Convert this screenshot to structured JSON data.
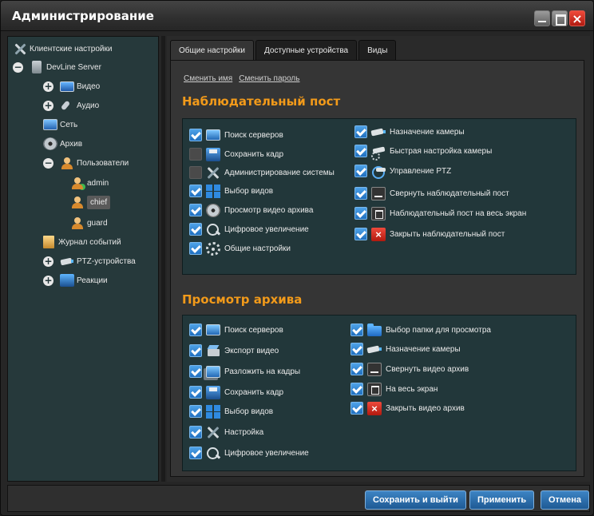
{
  "window": {
    "title": "Администрирование",
    "controls": {
      "minimize": "minimize-icon",
      "maximize": "maximize-icon",
      "close": "×"
    }
  },
  "tree": {
    "items": [
      {
        "label": "Клиентские настройки",
        "icon": "tools-icon"
      },
      {
        "label": "DevLine Server",
        "icon": "server-icon",
        "expander": "−"
      },
      {
        "label": "Видео",
        "icon": "monitor-icon",
        "expander": "+"
      },
      {
        "label": "Аудио",
        "icon": "microphone-icon",
        "expander": "+"
      },
      {
        "label": "Сеть",
        "icon": "network-icon"
      },
      {
        "label": "Архив",
        "icon": "archive-reel-icon"
      },
      {
        "label": "Пользователи",
        "icon": "users-icon",
        "expander": "−"
      },
      {
        "label": "admin",
        "icon": "user-admin-icon"
      },
      {
        "label": "chief",
        "icon": "user-icon",
        "selected": true
      },
      {
        "label": "guard",
        "icon": "user-icon"
      },
      {
        "label": "Журнал событий",
        "icon": "journal-icon"
      },
      {
        "label": "PTZ-устройства",
        "icon": "ptz-camera-icon",
        "expander": "+"
      },
      {
        "label": "Реакции",
        "icon": "reactions-icon",
        "expander": "+"
      }
    ]
  },
  "tabs": [
    {
      "label": "Общие настройки",
      "active": true
    },
    {
      "label": "Доступные устройства",
      "active": false
    },
    {
      "label": "Виды",
      "active": false
    }
  ],
  "links": {
    "change_name": "Сменить имя",
    "change_password": "Сменить пароль"
  },
  "sections": {
    "observation": {
      "title": "Наблюдательный пост",
      "left": [
        {
          "label": "Поиск серверов",
          "checked": true,
          "icon": "monitor-icon"
        },
        {
          "label": "Сохранить кадр",
          "checked": false,
          "icon": "save-icon"
        },
        {
          "label": "Администрирование системы",
          "checked": false,
          "icon": "tools-icon"
        },
        {
          "label": "Выбор видов",
          "checked": true,
          "icon": "grid-icon"
        },
        {
          "label": "Просмотр видео архива",
          "checked": true,
          "icon": "film-reel-icon"
        },
        {
          "label": "Цифровое увеличение",
          "checked": true,
          "icon": "zoom-icon"
        },
        {
          "label": "Общие настройки",
          "checked": true,
          "icon": "gear-icon"
        }
      ],
      "right": [
        {
          "label": "Назначение камеры",
          "checked": true,
          "icon": "camera-icon"
        },
        {
          "label": "Быстрая настройка камеры",
          "checked": true,
          "icon": "camera-gear-icon"
        },
        {
          "label": "Управление PTZ",
          "checked": true,
          "icon": "ptz-icon"
        },
        {
          "label": "Свернуть наблюдательный пост",
          "checked": true,
          "icon": "minimize-icon"
        },
        {
          "label": "Наблюдательный пост на весь экран",
          "checked": true,
          "icon": "maximize-icon"
        },
        {
          "label": "Закрыть наблюдательный пост",
          "checked": true,
          "icon": "close-icon"
        }
      ]
    },
    "archive": {
      "title": "Просмотр архива",
      "left": [
        {
          "label": "Поиск серверов",
          "checked": true,
          "icon": "monitor-icon"
        },
        {
          "label": "Экспорт видео",
          "checked": true,
          "icon": "export-icon"
        },
        {
          "label": "Разложить на кадры",
          "checked": true,
          "icon": "frames-icon"
        },
        {
          "label": "Сохранить кадр",
          "checked": true,
          "icon": "save-icon"
        },
        {
          "label": "Выбор видов",
          "checked": true,
          "icon": "grid-icon"
        },
        {
          "label": "Настройка",
          "checked": true,
          "icon": "tools-icon"
        },
        {
          "label": "Цифровое увеличение",
          "checked": true,
          "icon": "zoom-icon"
        }
      ],
      "right": [
        {
          "label": "Выбор папки для просмотра",
          "checked": true,
          "icon": "folder-icon"
        },
        {
          "label": "Назначение камеры",
          "checked": true,
          "icon": "camera-icon"
        },
        {
          "label": "Свернуть видео архив",
          "checked": true,
          "icon": "minimize-icon"
        },
        {
          "label": "На весь экран",
          "checked": true,
          "icon": "maximize-icon"
        },
        {
          "label": "Закрыть видео архив",
          "checked": true,
          "icon": "close-icon"
        }
      ]
    }
  },
  "buttons": {
    "save_exit": "Сохранить и выйти",
    "apply": "Применить",
    "cancel": "Отмена"
  },
  "colors": {
    "accent": "#f29a1a",
    "panel": "#22373a",
    "button": "#2a6fad",
    "close": "#d12a1e"
  }
}
